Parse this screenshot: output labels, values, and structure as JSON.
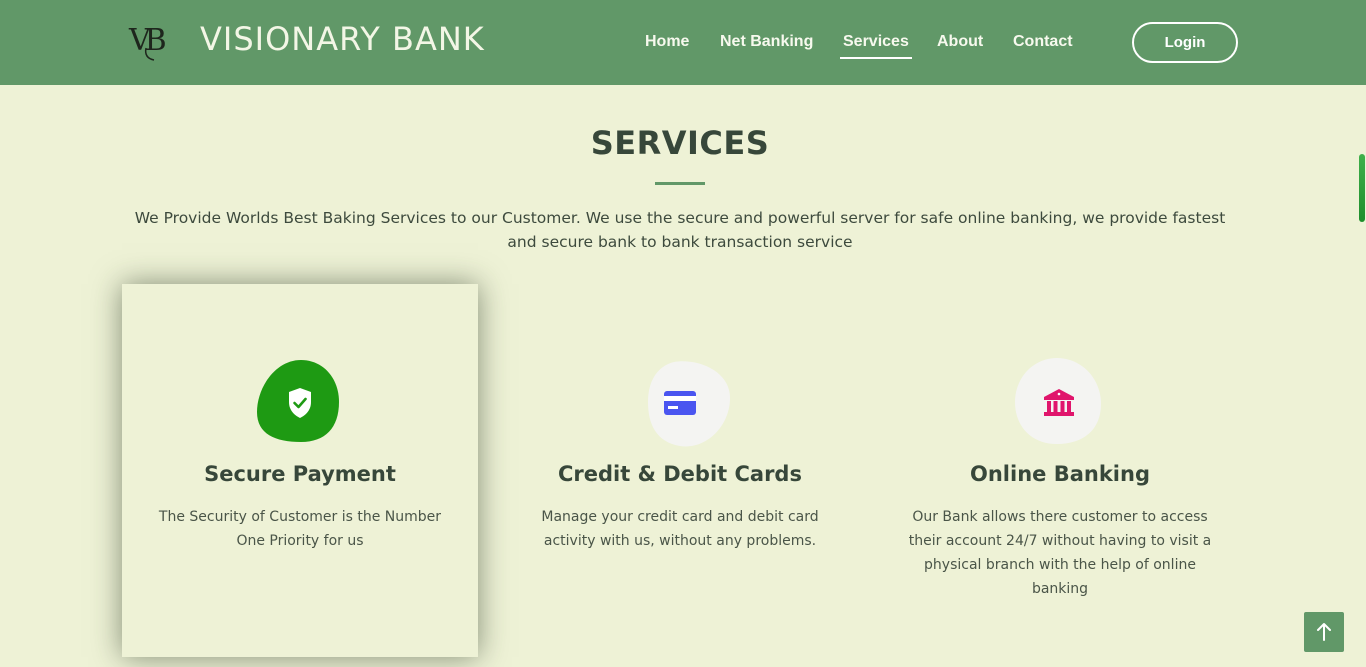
{
  "brand": {
    "logo_text": "VB",
    "name": "VISIONARY BANK"
  },
  "nav": {
    "items": [
      {
        "label": "Home"
      },
      {
        "label": "Net Banking"
      },
      {
        "label": "Services"
      },
      {
        "label": "About"
      },
      {
        "label": "Contact"
      }
    ],
    "active": "Services",
    "login_label": "Login"
  },
  "services": {
    "title": "SERVICES",
    "intro": "We Provide Worlds Best Baking Services to our Customer. We use the secure and powerful server for safe online banking, we provide fastest and secure bank to bank transaction service",
    "cards": [
      {
        "icon": "shield-check-icon",
        "title": "Secure Payment",
        "description": "The Security of Customer is the Number One Priority for us",
        "accent": "#1e9a13"
      },
      {
        "icon": "credit-card-icon",
        "title": "Credit & Debit Cards",
        "description": "Manage your credit card and debit card activity with us, without any problems.",
        "accent": "#4a55f0"
      },
      {
        "icon": "bank-icon",
        "title": "Online Banking",
        "description": "Our Bank allows there customer to access their account 24/7 without having to visit a physical branch with the help of online banking",
        "accent": "#e0156c"
      }
    ]
  },
  "colors": {
    "header": "#619868",
    "page_background": "#eef2d6",
    "heading_text": "#37473a"
  },
  "back_to_top": {
    "icon": "arrow-up-icon"
  }
}
